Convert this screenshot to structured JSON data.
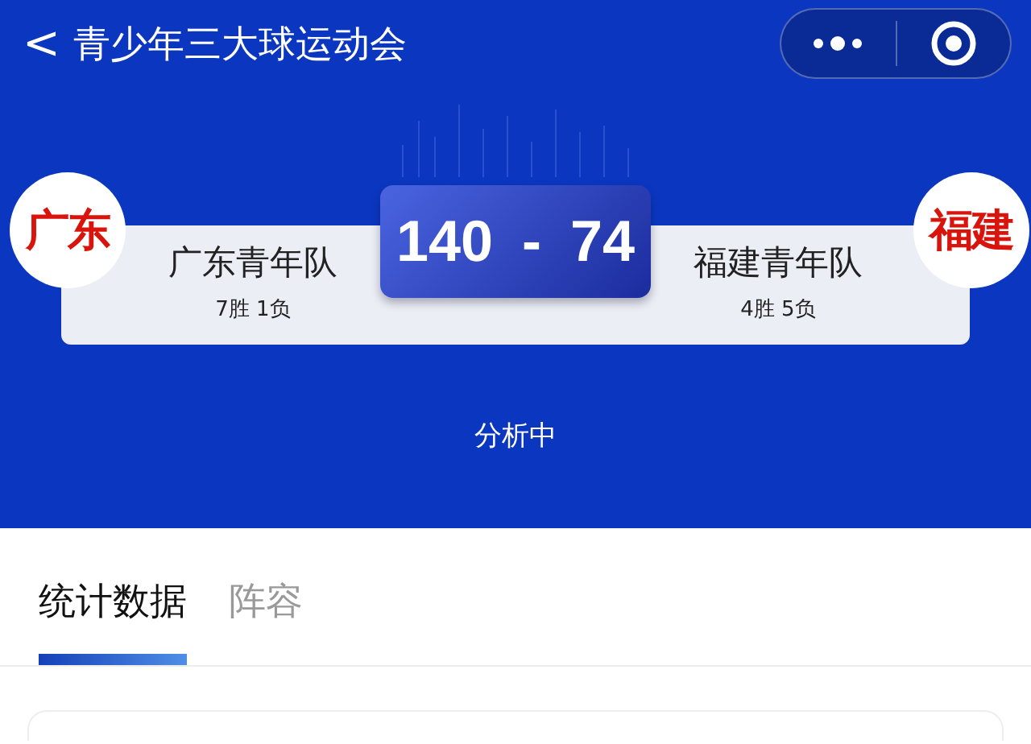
{
  "nav": {
    "back": "<",
    "title": "青少年三大球运动会"
  },
  "match": {
    "home": {
      "logo_text": "广东",
      "name": "广东青年队",
      "record": "7胜 1负"
    },
    "away": {
      "logo_text": "福建",
      "name": "福建青年队",
      "record": "4胜 5负"
    },
    "home_score": "140",
    "separator": "-",
    "away_score": "74",
    "status": "分析中"
  },
  "tabs": [
    {
      "label": "统计数据",
      "selected": true
    },
    {
      "label": "阵容",
      "selected": false
    }
  ]
}
